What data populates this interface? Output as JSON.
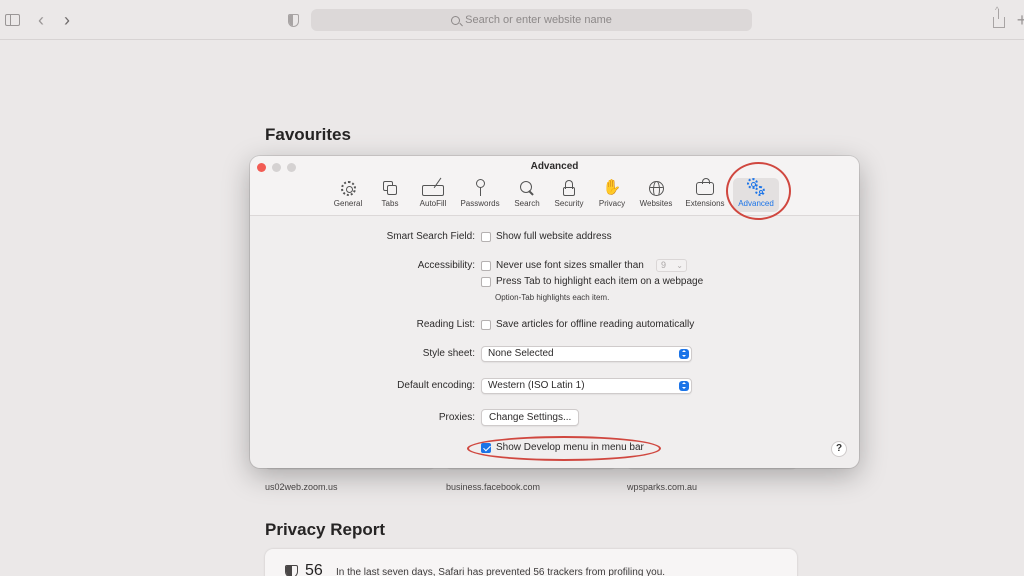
{
  "browser": {
    "address_placeholder": "Search or enter website name"
  },
  "start_page": {
    "favourites_title": "Favourites",
    "favourites": [
      {
        "label": "us02web.zoom.us"
      },
      {
        "label": "business.facebook.com"
      },
      {
        "label": "wpsparks.com.au"
      }
    ],
    "privacy_title": "Privacy Report",
    "privacy_count": "56",
    "privacy_message": "In the last seven days, Safari has prevented 56 trackers from profiling you."
  },
  "prefs": {
    "title": "Advanced",
    "tabs": [
      {
        "label": "General",
        "icon": "gear-icon"
      },
      {
        "label": "Tabs",
        "icon": "tabs-icon"
      },
      {
        "label": "AutoFill",
        "icon": "autofill-icon"
      },
      {
        "label": "Passwords",
        "icon": "key-icon"
      },
      {
        "label": "Search",
        "icon": "search-icon"
      },
      {
        "label": "Security",
        "icon": "lock-icon"
      },
      {
        "label": "Privacy",
        "icon": "hand-icon"
      },
      {
        "label": "Websites",
        "icon": "globe-icon"
      },
      {
        "label": "Extensions",
        "icon": "puzzle-icon"
      },
      {
        "label": "Advanced",
        "icon": "gears-icon",
        "active": true
      }
    ],
    "smart_search": {
      "label": "Smart Search Field:",
      "option": "Show full website address",
      "checked": false
    },
    "accessibility": {
      "label": "Accessibility:",
      "font_option": "Never use font sizes smaller than",
      "font_size": "9",
      "tab_option": "Press Tab to highlight each item on a webpage",
      "tab_hint": "Option-Tab highlights each item."
    },
    "reading_list": {
      "label": "Reading List:",
      "option": "Save articles for offline reading automatically",
      "checked": false
    },
    "style_sheet": {
      "label": "Style sheet:",
      "value": "None Selected"
    },
    "default_encoding": {
      "label": "Default encoding:",
      "value": "Western (ISO Latin 1)"
    },
    "proxies": {
      "label": "Proxies:",
      "button": "Change Settings..."
    },
    "develop_menu": {
      "option": "Show Develop menu in menu bar",
      "checked": true
    },
    "help": "?"
  },
  "colors": {
    "accent": "#1b74e8",
    "annotation": "#d0473f",
    "close": "#f25c54"
  }
}
